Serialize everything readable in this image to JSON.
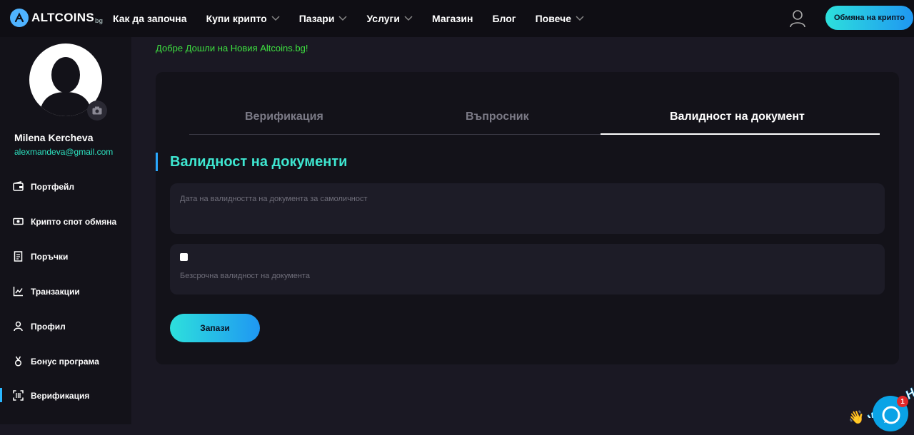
{
  "header": {
    "logo_text": "ALTCOINS",
    "logo_suffix": "bg",
    "nav": [
      {
        "label": "Как да започна",
        "dropdown": false
      },
      {
        "label": "Купи крипто",
        "dropdown": true
      },
      {
        "label": "Пазари",
        "dropdown": true
      },
      {
        "label": "Услуги",
        "dropdown": true
      },
      {
        "label": "Магазин",
        "dropdown": false
      },
      {
        "label": "Блог",
        "dropdown": false
      },
      {
        "label": "Повече",
        "dropdown": true
      }
    ],
    "exchange_button": "Обмяна на крипто"
  },
  "sidebar": {
    "user_name": "Milena Kercheva",
    "user_email": "alexmandeva@gmail.com",
    "items": [
      {
        "label": "Портфейл",
        "icon": "wallet-icon"
      },
      {
        "label": "Крипто спот обмяна",
        "icon": "cash-icon"
      },
      {
        "label": "Поръчки",
        "icon": "receipt-icon"
      },
      {
        "label": "Транзакции",
        "icon": "chart-icon"
      },
      {
        "label": "Профил",
        "icon": "person-icon"
      },
      {
        "label": "Бонус програма",
        "icon": "medal-icon"
      },
      {
        "label": "Верификация",
        "icon": "scan-icon",
        "active": true
      }
    ]
  },
  "main": {
    "welcome": "Добре Дошли на Новия Altcoins.bg!",
    "tabs": [
      {
        "label": "Верификация",
        "active": false
      },
      {
        "label": "Въпросник",
        "active": false
      },
      {
        "label": "Валидност на документ",
        "active": true
      }
    ],
    "section_title": "Валидност на документи",
    "date_field_placeholder": "Дата на валидността на документа за самоличност",
    "checkbox_label": "Безсрочна валидност на документа",
    "checkbox_checked": false,
    "save_button": "Запази"
  },
  "chat": {
    "text": "We Are Here",
    "badge": "1"
  },
  "colors": {
    "accent_teal": "#3ee6d0",
    "accent_blue": "#1f97f2",
    "welcome_green": "#3ee040",
    "email_teal": "#2de3c1"
  }
}
